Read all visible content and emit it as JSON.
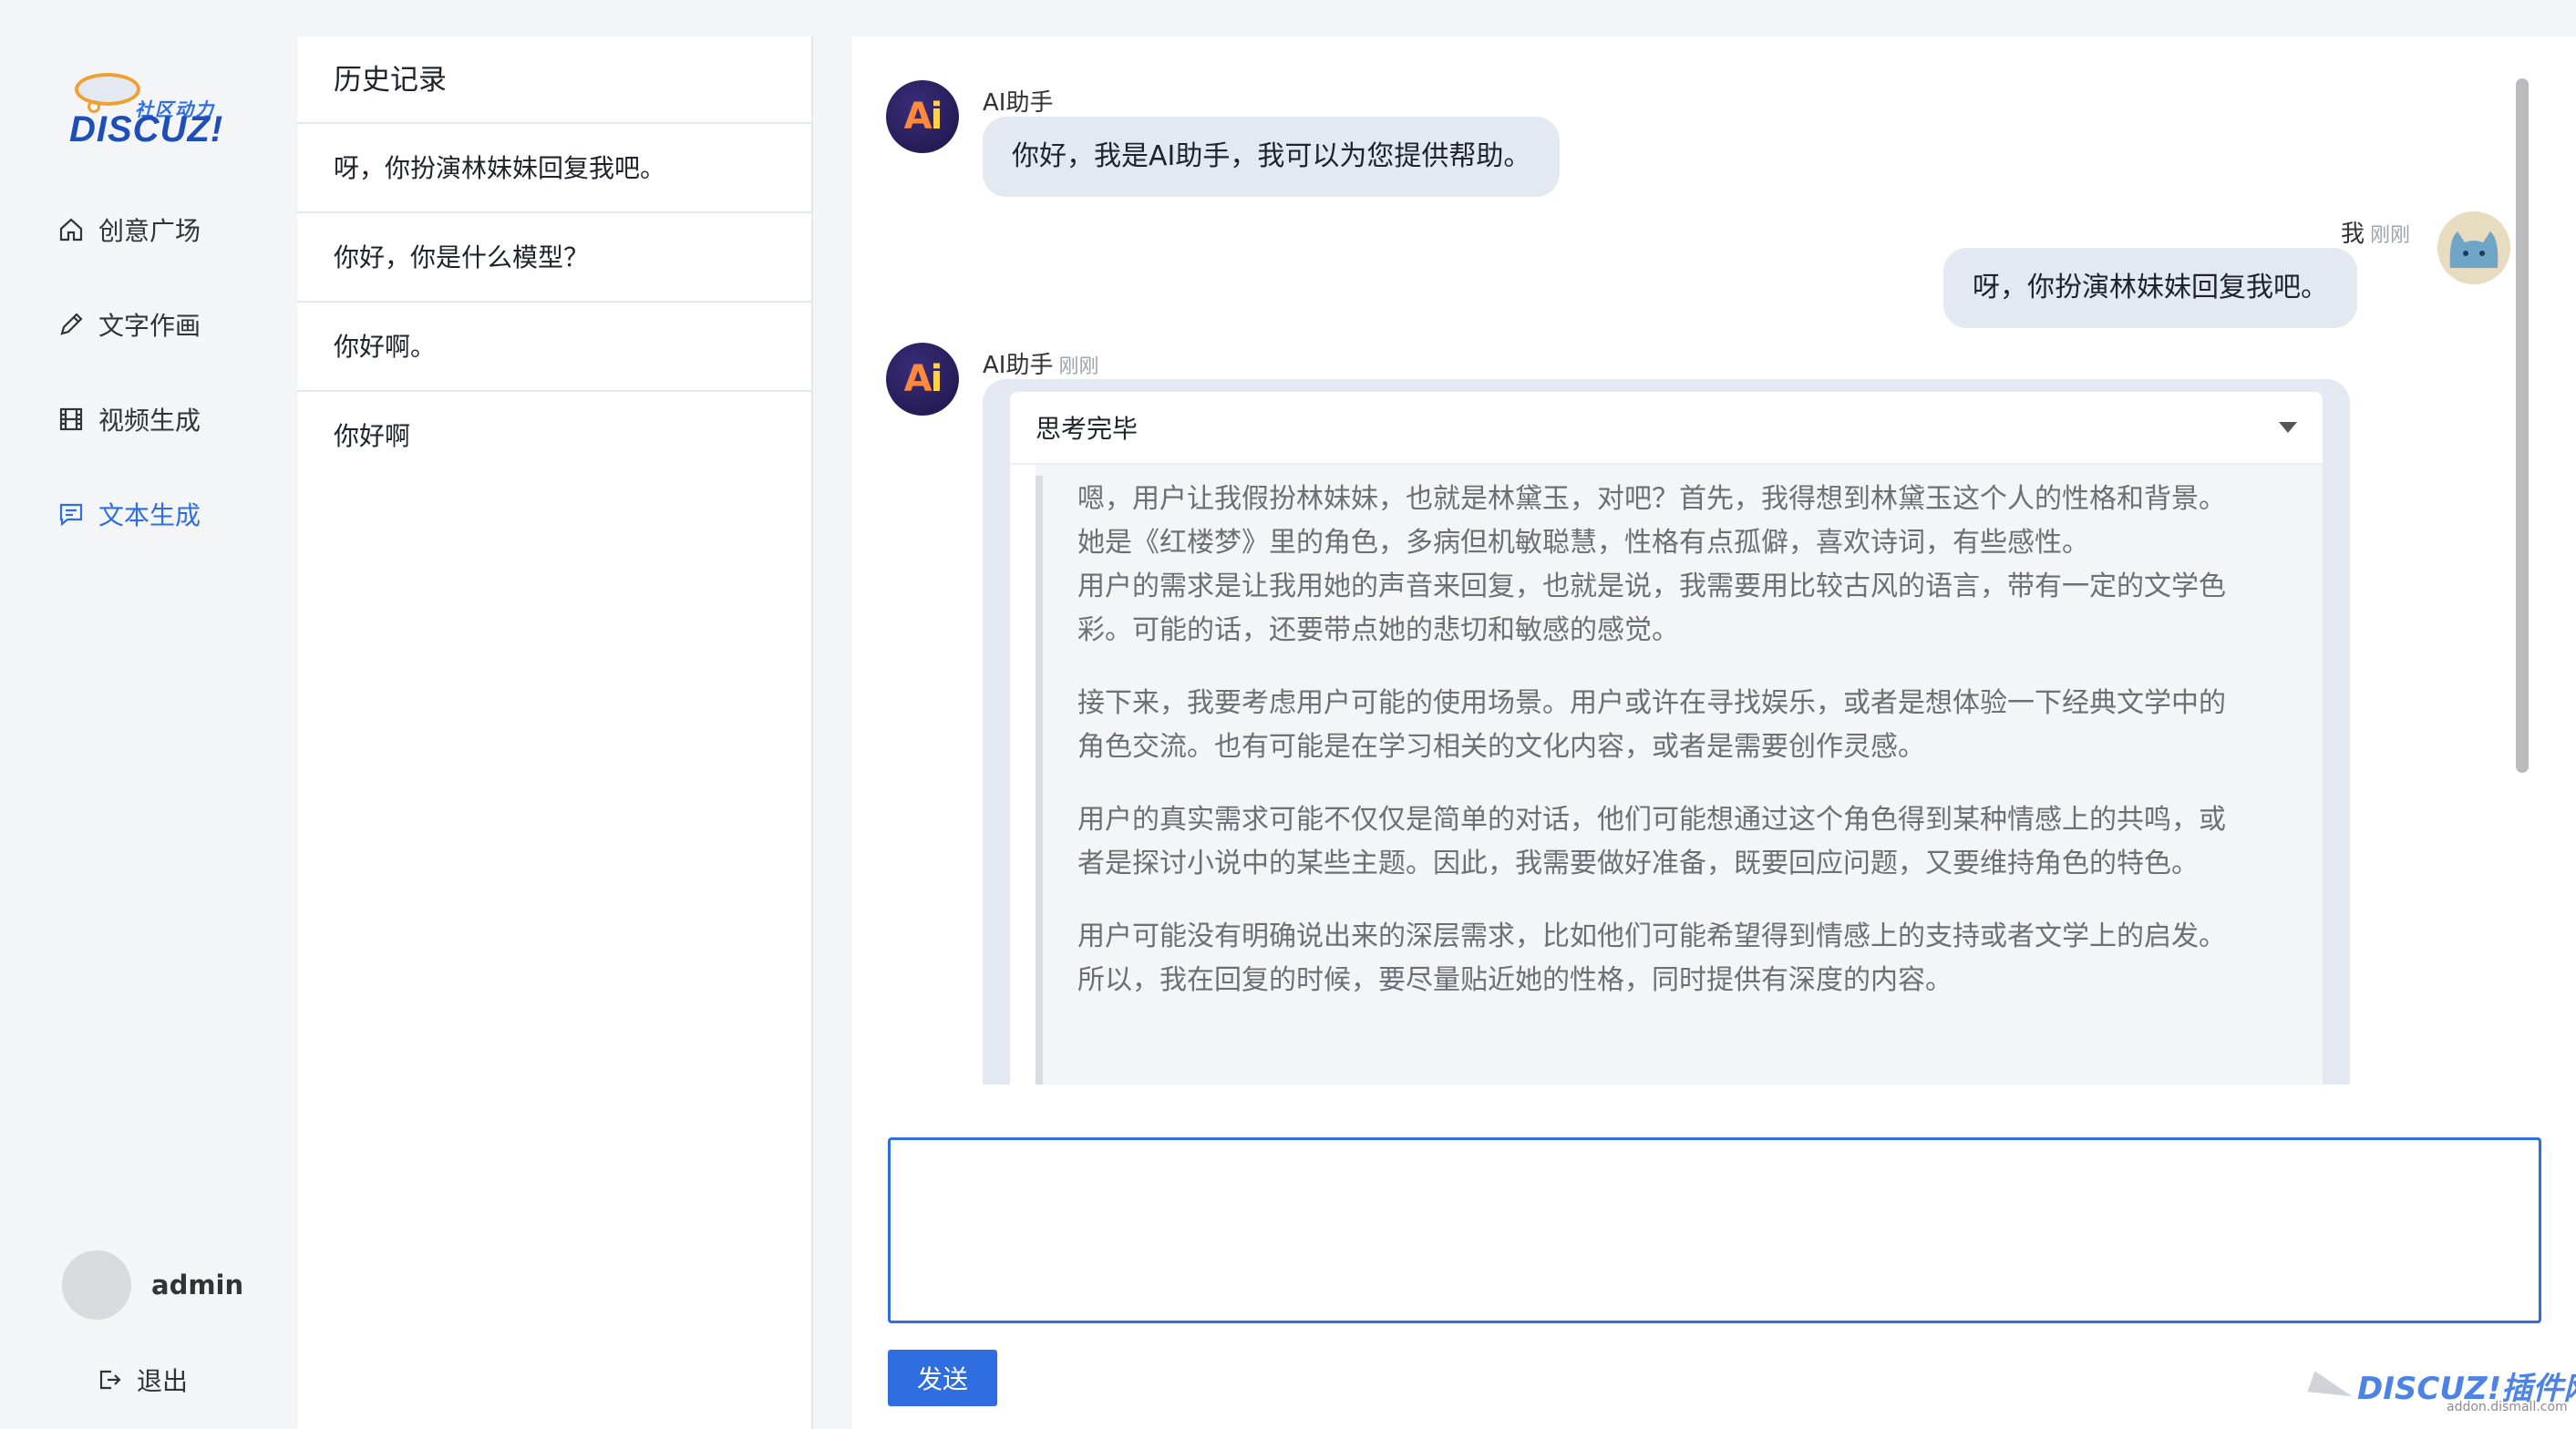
{
  "brand": {
    "tagline": "社区动力",
    "name": "DISCUZ!"
  },
  "nav": {
    "items": [
      {
        "label": "创意广场",
        "icon": "home-icon"
      },
      {
        "label": "文字作画",
        "icon": "pencil-icon"
      },
      {
        "label": "视频生成",
        "icon": "film-icon"
      },
      {
        "label": "文本生成",
        "icon": "chat-icon",
        "active": true
      }
    ],
    "user": {
      "name": "admin"
    },
    "logout_label": "退出"
  },
  "history": {
    "title": "历史记录",
    "items": [
      "呀，你扮演林妹妹回复我吧。",
      "你好，你是什么模型？",
      "你好啊。",
      "你好啊"
    ]
  },
  "chat": {
    "messages": [
      {
        "sender": "AI助手",
        "time": "",
        "text": "你好，我是AI助手，我可以为您提供帮助。"
      },
      {
        "sender": "我",
        "time": "刚刚",
        "text": "呀，你扮演林妹妹回复我吧。"
      },
      {
        "sender": "AI助手",
        "time": "刚刚",
        "thinking_label": "思考完毕",
        "thinking": [
          "嗯，用户让我假扮林妹妹，也就是林黛玉，对吧？首先，我得想到林黛玉这个人的性格和背景。她是《红楼梦》里的角色，多病但机敏聪慧，性格有点孤僻，喜欢诗词，有些感性。",
          "用户的需求是让我用她的声音来回复，也就是说，我需要用比较古风的语言，带有一定的文学色彩。可能的话，还要带点她的悲切和敏感的感觉。",
          "接下来，我要考虑用户可能的使用场景。用户或许在寻找娱乐，或者是想体验一下经典文学中的角色交流。也有可能是在学习相关的文化内容，或者是需要创作灵感。",
          "用户的真实需求可能不仅仅是简单的对话，他们可能想通过这个角色得到某种情感上的共鸣，或者是探讨小说中的某些主题。因此，我需要做好准备，既要回应问题，又要维持角色的特色。",
          "用户可能没有明确说出来的深层需求，比如他们可能希望得到情感上的支持或者文学上的启发。所以，我在回复的时候，要尽量贴近她的性格，同时提供有深度的内容。"
        ]
      }
    ],
    "input_value": "",
    "send_label": "发送"
  },
  "watermark": {
    "text": "DISCUZ!插件网",
    "sub": "addon.dismall.com"
  },
  "colors": {
    "accent": "#2f6ee0",
    "bubble": "#e4e8f1",
    "background": "#f4f5f7"
  }
}
